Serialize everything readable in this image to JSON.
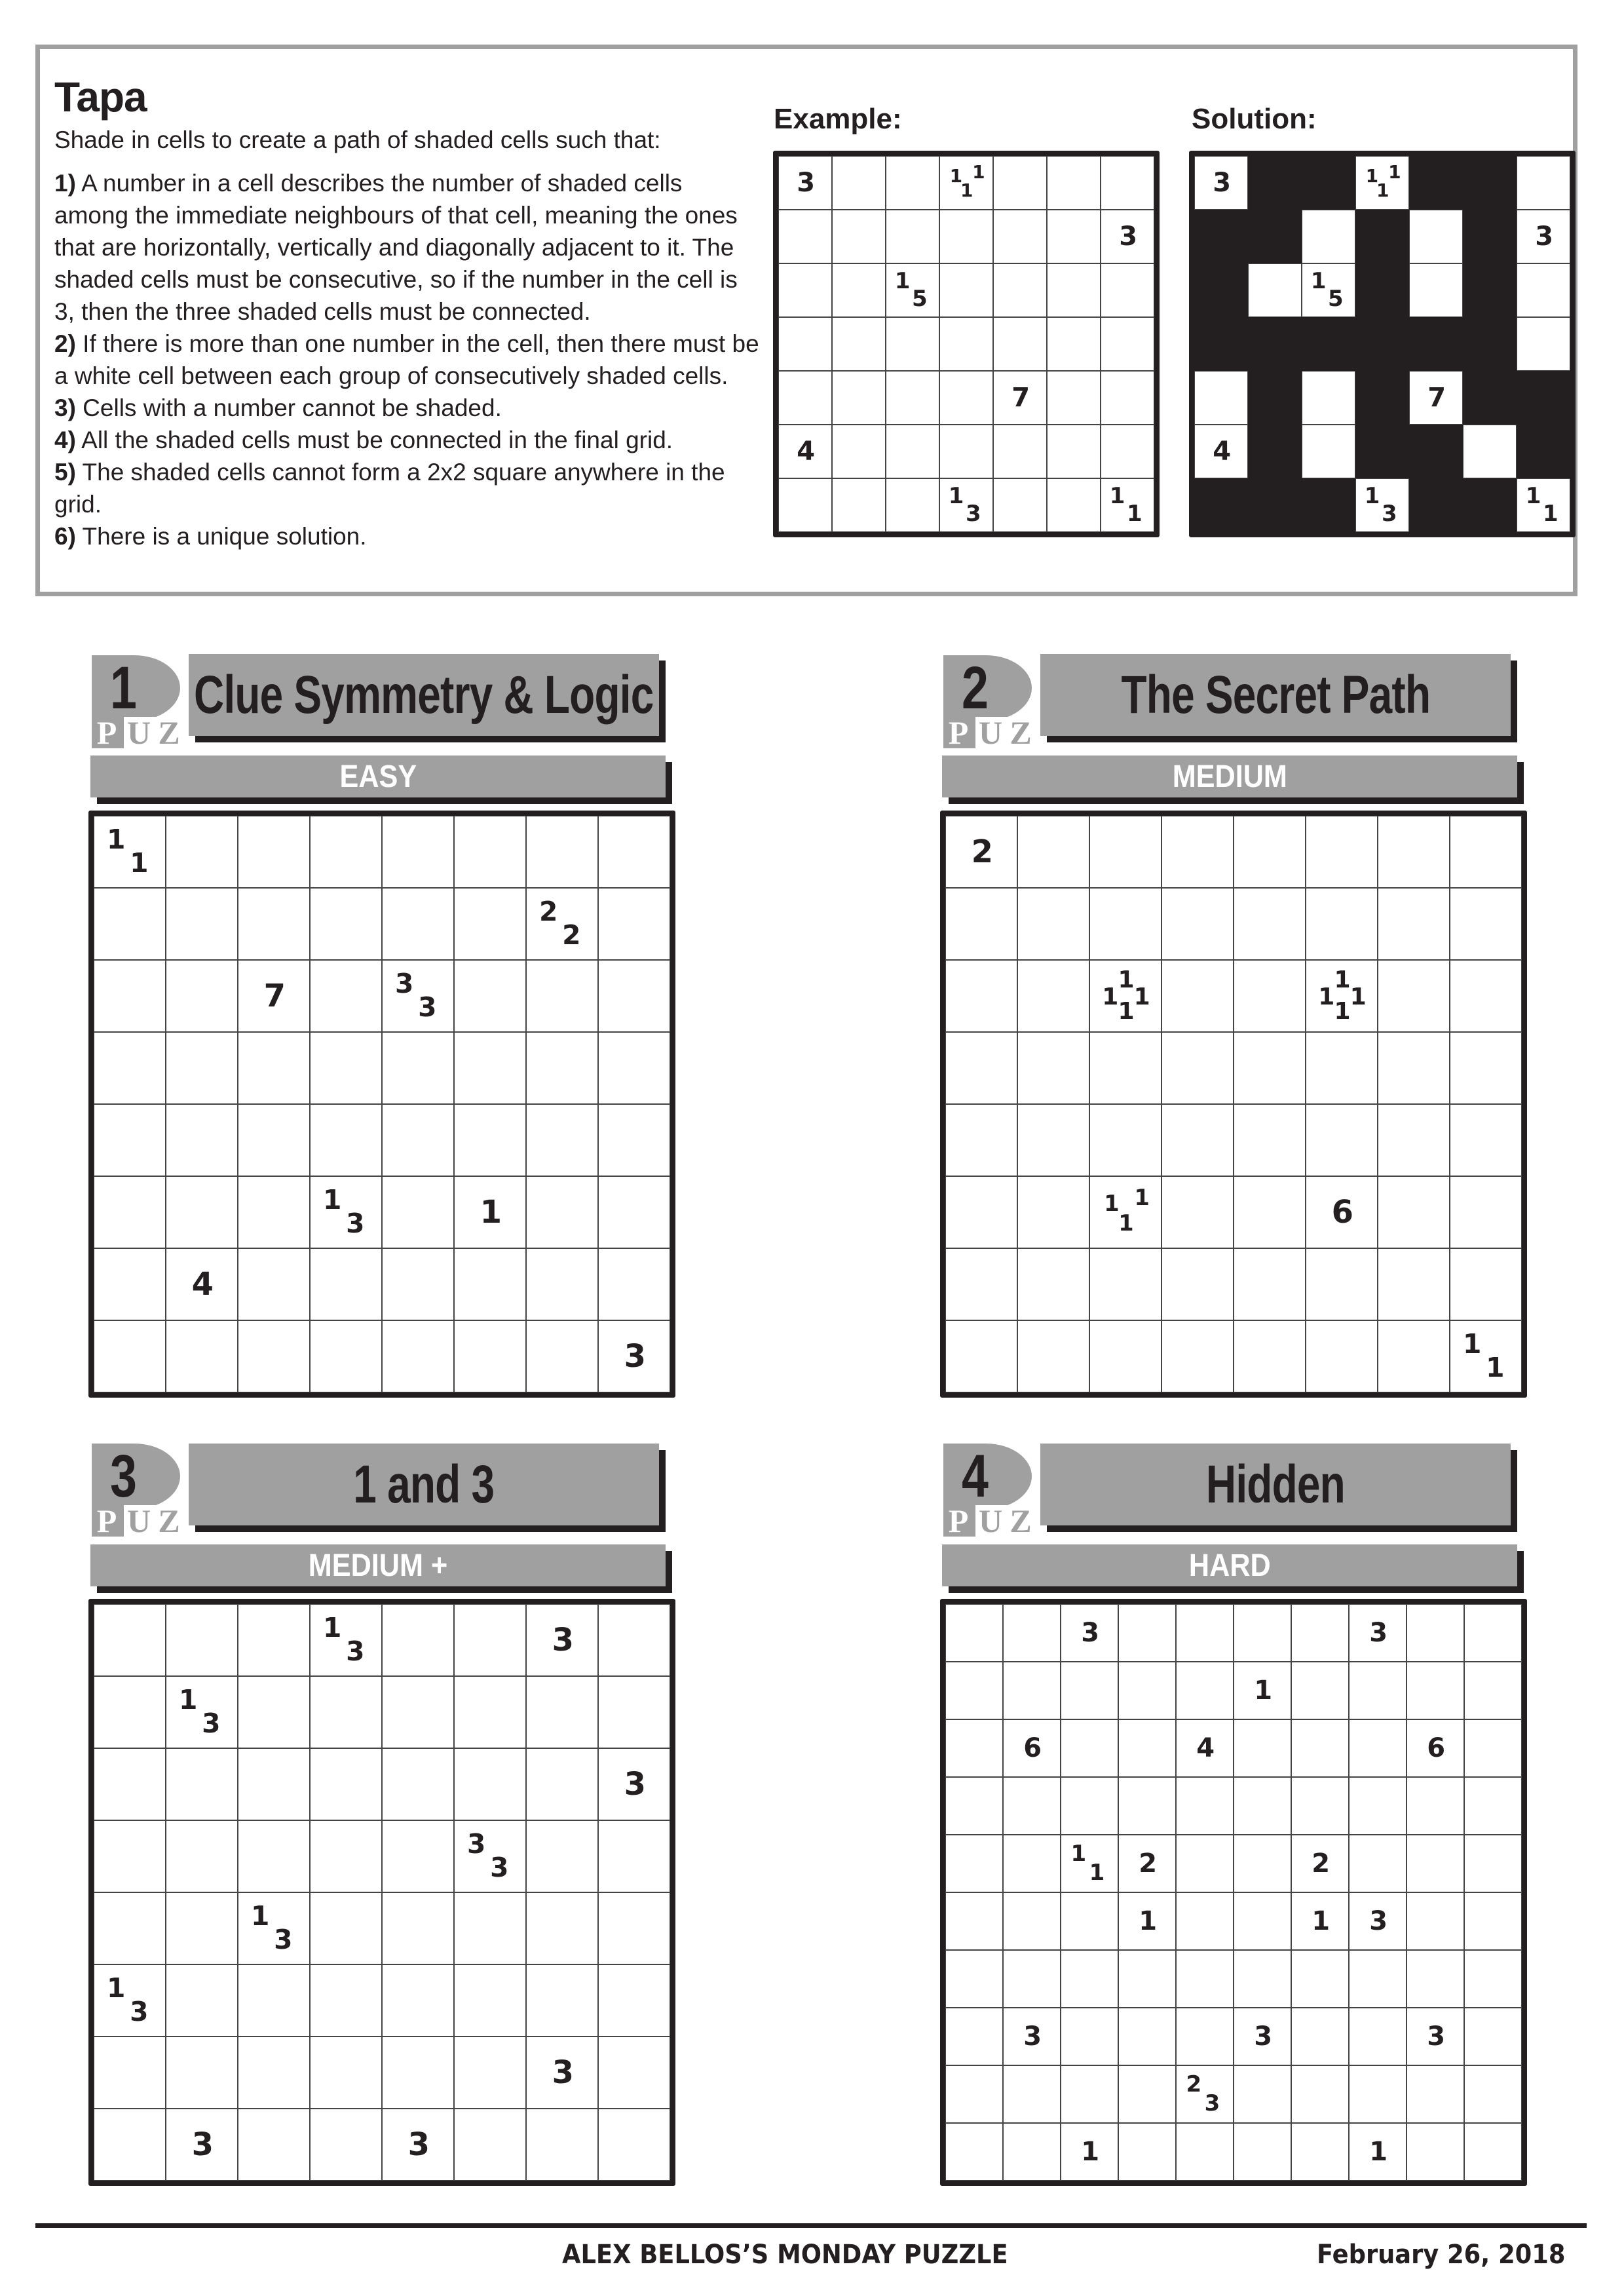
{
  "rules": {
    "title": "Tapa",
    "intro": "Shade in cells to create a path of shaded cells such that:",
    "items": [
      {
        "num": "1)",
        "text": " A number in a cell describes the number of shaded cells among the immediate neighbours of that cell, meaning the ones that are horizontally, vertically and diagonally adjacent to it. The shaded cells must be consecutive, so if the number in the cell is 3, then the three shaded cells must be connected."
      },
      {
        "num": "2)",
        "text": " If there is more than one number in the cell, then there must be a white cell between each group of consecutively shaded cells."
      },
      {
        "num": "3)",
        "text": " Cells with a number cannot be shaded."
      },
      {
        "num": "4)",
        "text": " All the shaded cells must be connected in the final grid."
      },
      {
        "num": "5)",
        "text": " The shaded cells cannot form a 2x2 square anywhere in the grid."
      },
      {
        "num": "6)",
        "text": " There is a unique solution."
      }
    ],
    "example_label": "Example:",
    "solution_label": "Solution:"
  },
  "example": {
    "size": 7,
    "clues": [
      {
        "r": 0,
        "c": 0,
        "v": [
          "3"
        ]
      },
      {
        "r": 0,
        "c": 3,
        "v": [
          "1",
          "1",
          "1"
        ],
        "layout": "tri-ul"
      },
      {
        "r": 1,
        "c": 6,
        "v": [
          "3"
        ]
      },
      {
        "r": 2,
        "c": 2,
        "v": [
          "1",
          "5"
        ]
      },
      {
        "r": 4,
        "c": 4,
        "v": [
          "7"
        ]
      },
      {
        "r": 5,
        "c": 0,
        "v": [
          "4"
        ]
      },
      {
        "r": 6,
        "c": 3,
        "v": [
          "1",
          "3"
        ]
      },
      {
        "r": 6,
        "c": 6,
        "v": [
          "1",
          "1"
        ]
      }
    ]
  },
  "solution": {
    "size": 7,
    "shaded": [
      "0110110",
      "1101010",
      "1001010",
      "1111110",
      "0101011",
      "0101101",
      "1110110"
    ]
  },
  "puzzles": [
    {
      "number": "1",
      "logo_letters": [
        "P",
        "U",
        "Z"
      ],
      "title": "Clue Symmetry & Logic",
      "difficulty": "EASY",
      "size": 8,
      "clues": [
        {
          "r": 0,
          "c": 0,
          "v": [
            "1",
            "1"
          ]
        },
        {
          "r": 1,
          "c": 6,
          "v": [
            "2",
            "2"
          ]
        },
        {
          "r": 2,
          "c": 2,
          "v": [
            "7"
          ]
        },
        {
          "r": 2,
          "c": 4,
          "v": [
            "3",
            "3"
          ]
        },
        {
          "r": 5,
          "c": 3,
          "v": [
            "1",
            "3"
          ]
        },
        {
          "r": 5,
          "c": 5,
          "v": [
            "1"
          ]
        },
        {
          "r": 6,
          "c": 1,
          "v": [
            "4"
          ]
        },
        {
          "r": 7,
          "c": 7,
          "v": [
            "3"
          ]
        }
      ]
    },
    {
      "number": "2",
      "logo_letters": [
        "P",
        "U",
        "Z"
      ],
      "title": "The Secret Path",
      "difficulty": "MEDIUM",
      "size": 8,
      "clues": [
        {
          "r": 0,
          "c": 0,
          "v": [
            "2"
          ]
        },
        {
          "r": 2,
          "c": 2,
          "v": [
            "1",
            "1",
            "1",
            "1"
          ],
          "layout": "quad"
        },
        {
          "r": 2,
          "c": 5,
          "v": [
            "1",
            "1",
            "1",
            "1"
          ],
          "layout": "quad"
        },
        {
          "r": 5,
          "c": 2,
          "v": [
            "1",
            "1",
            "1"
          ],
          "layout": "tri-ul"
        },
        {
          "r": 5,
          "c": 5,
          "v": [
            "6"
          ]
        },
        {
          "r": 7,
          "c": 7,
          "v": [
            "1",
            "1"
          ]
        }
      ]
    },
    {
      "number": "3",
      "logo_letters": [
        "P",
        "U",
        "Z"
      ],
      "title": "1 and 3",
      "difficulty": "MEDIUM +",
      "size": 8,
      "clues": [
        {
          "r": 0,
          "c": 3,
          "v": [
            "1",
            "3"
          ]
        },
        {
          "r": 0,
          "c": 6,
          "v": [
            "3"
          ]
        },
        {
          "r": 1,
          "c": 1,
          "v": [
            "1",
            "3"
          ]
        },
        {
          "r": 2,
          "c": 7,
          "v": [
            "3"
          ]
        },
        {
          "r": 3,
          "c": 5,
          "v": [
            "3",
            "3"
          ]
        },
        {
          "r": 4,
          "c": 2,
          "v": [
            "1",
            "3"
          ]
        },
        {
          "r": 5,
          "c": 0,
          "v": [
            "1",
            "3"
          ]
        },
        {
          "r": 6,
          "c": 6,
          "v": [
            "3"
          ]
        },
        {
          "r": 7,
          "c": 1,
          "v": [
            "3"
          ]
        },
        {
          "r": 7,
          "c": 4,
          "v": [
            "3"
          ]
        }
      ]
    },
    {
      "number": "4",
      "logo_letters": [
        "P",
        "U",
        "Z"
      ],
      "title": "Hidden",
      "difficulty": "HARD",
      "size": 10,
      "clues": [
        {
          "r": 0,
          "c": 2,
          "v": [
            "3"
          ]
        },
        {
          "r": 0,
          "c": 7,
          "v": [
            "3"
          ]
        },
        {
          "r": 1,
          "c": 5,
          "v": [
            "1"
          ]
        },
        {
          "r": 2,
          "c": 1,
          "v": [
            "6"
          ]
        },
        {
          "r": 2,
          "c": 4,
          "v": [
            "4"
          ]
        },
        {
          "r": 2,
          "c": 8,
          "v": [
            "6"
          ]
        },
        {
          "r": 4,
          "c": 2,
          "v": [
            "1",
            "1"
          ]
        },
        {
          "r": 4,
          "c": 3,
          "v": [
            "2"
          ]
        },
        {
          "r": 4,
          "c": 6,
          "v": [
            "2"
          ]
        },
        {
          "r": 5,
          "c": 3,
          "v": [
            "1"
          ]
        },
        {
          "r": 5,
          "c": 6,
          "v": [
            "1"
          ]
        },
        {
          "r": 5,
          "c": 7,
          "v": [
            "3"
          ]
        },
        {
          "r": 7,
          "c": 1,
          "v": [
            "3"
          ]
        },
        {
          "r": 7,
          "c": 5,
          "v": [
            "3"
          ]
        },
        {
          "r": 7,
          "c": 8,
          "v": [
            "3"
          ]
        },
        {
          "r": 8,
          "c": 4,
          "v": [
            "2",
            "3"
          ]
        },
        {
          "r": 9,
          "c": 2,
          "v": [
            "1"
          ]
        },
        {
          "r": 9,
          "c": 7,
          "v": [
            "1"
          ]
        }
      ]
    }
  ],
  "footer": {
    "title": "ALEX BELLOS’S MONDAY PUZZLE",
    "date": "February 26, 2018"
  },
  "colors": {
    "ink": "#231f20",
    "header_gray": "#a0a0a0",
    "frame_gray": "#a0a0a0"
  }
}
